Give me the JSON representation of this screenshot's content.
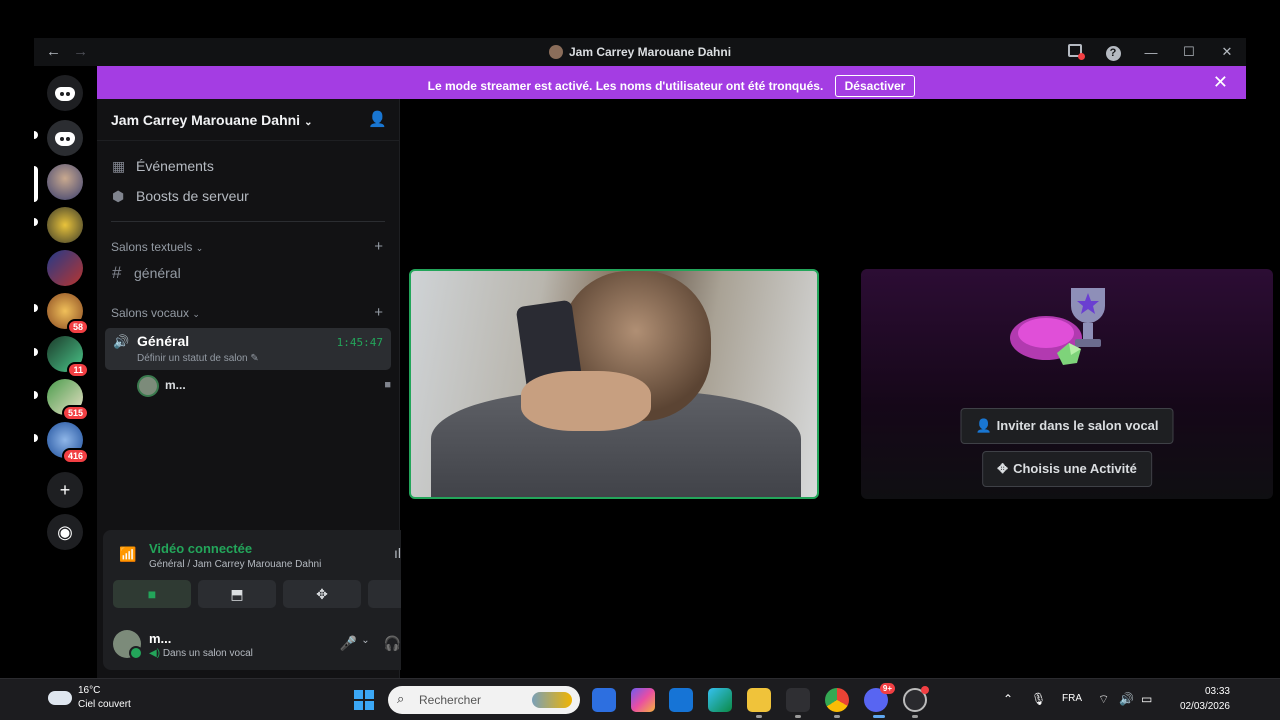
{
  "window": {
    "title": "Jam Carrey Marouane Dahni",
    "back_glyph": "←",
    "forward_glyph": "→",
    "minimize_glyph": "—",
    "maximize_glyph": "☐",
    "close_glyph": "✕",
    "help_glyph": "?"
  },
  "banner": {
    "text": "Le mode streamer est activé. Les noms d'utilisateur ont été tronqués.",
    "button": "Désactiver",
    "close_glyph": "✕",
    "color": "#a43de3"
  },
  "rail": {
    "badges": [
      "58",
      "11",
      "515",
      "416"
    ],
    "add_glyph": "+"
  },
  "sidebar": {
    "guild_name": "Jam Carrey Marouane Dahni",
    "items": [
      {
        "label": "Événements",
        "icon": "calendar-icon"
      },
      {
        "label": "Boosts de serveur",
        "icon": "boost-icon"
      }
    ],
    "text_category": "Salons textuels",
    "text_channel": "général",
    "voice_category": "Salons vocaux",
    "voice_channel": {
      "name": "Général",
      "timer": "1:45:47",
      "status_hint": "Définir un statut de salon"
    },
    "voice_user": "m..."
  },
  "voice_panel": {
    "title": "Vidéo connectée",
    "subtitle": "Général / Jam Carrey Marouane Dahni"
  },
  "user_bar": {
    "name": "m...",
    "status": "Dans un salon vocal"
  },
  "stage": {
    "invite_button": "Inviter dans le salon vocal",
    "activity_button": "Choisis une Activité"
  },
  "taskbar": {
    "temperature": "16°C",
    "weather": "Ciel couvert",
    "search_placeholder": "Rechercher",
    "discord_badge": "9+",
    "language": "FRA",
    "time": "03:33",
    "date": "02/03/2026"
  },
  "colors": {
    "accent_green": "#23a55a",
    "sidebar_bg": "#121214",
    "badge_red": "#f23f43"
  }
}
